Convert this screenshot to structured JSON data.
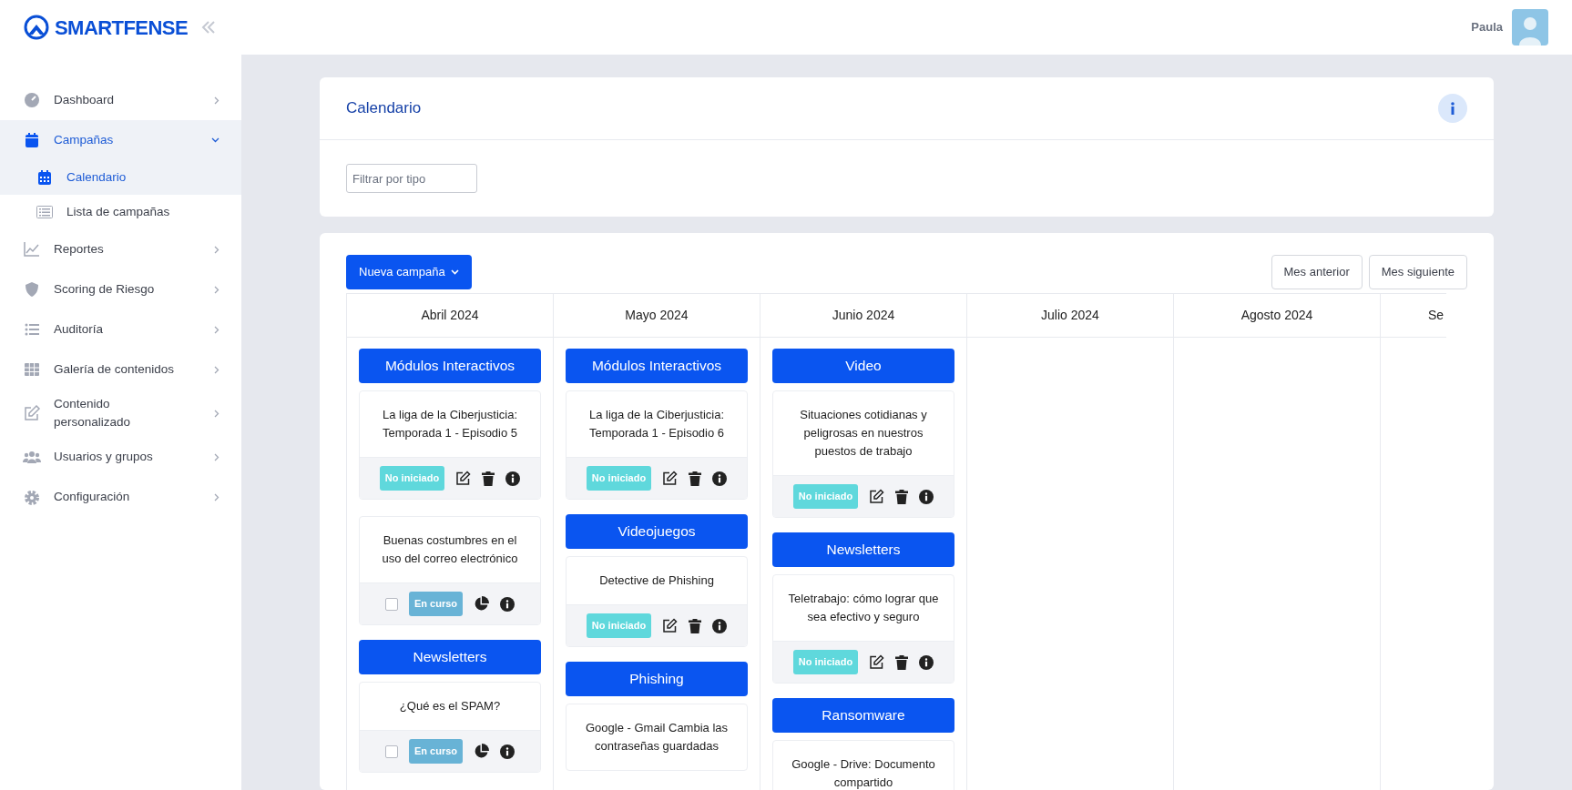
{
  "brand": "SMARTFENSE",
  "user": {
    "name": "Paula"
  },
  "sidebar": {
    "items": [
      {
        "label": "Dashboard",
        "kind": "gauge",
        "expanded": false,
        "selected": false
      },
      {
        "label": "Campañas",
        "kind": "calendar",
        "expanded": true,
        "selected": true,
        "children": [
          {
            "label": "Calendario",
            "kind": "calendar-grid",
            "selected": true
          },
          {
            "label": "Lista de campañas",
            "kind": "list",
            "selected": false
          }
        ]
      },
      {
        "label": "Reportes",
        "kind": "chart",
        "expanded": false,
        "selected": false
      },
      {
        "label": "Scoring de Riesgo",
        "kind": "shield",
        "expanded": false,
        "selected": false
      },
      {
        "label": "Auditoría",
        "kind": "bullets",
        "expanded": false,
        "selected": false
      },
      {
        "label": "Galería de contenidos",
        "kind": "grid",
        "expanded": false,
        "selected": false
      },
      {
        "label": "Contenido personalizado",
        "kind": "edit",
        "expanded": false,
        "selected": false
      },
      {
        "label": "Usuarios y grupos",
        "kind": "users",
        "expanded": false,
        "selected": false
      },
      {
        "label": "Configuración",
        "kind": "gear",
        "expanded": false,
        "selected": false
      }
    ]
  },
  "page": {
    "title": "Calendario",
    "filter": {
      "placeholder": "Filtrar por tipo"
    }
  },
  "calendar": {
    "new_button": "Nueva campaña",
    "prev_button": "Mes anterior",
    "next_button": "Mes siguiente",
    "months": [
      {
        "label": "Abril 2024",
        "groups": [
          {
            "category": "Módulos Interactivos",
            "items": [
              {
                "title": "La liga de la Ciberjusticia: Temporada 1 - Episodio 5",
                "kind": "pending",
                "status": "No iniciado"
              },
              {
                "title": "Buenas costumbres en el uso del correo electrónico",
                "kind": "running",
                "status": "En curso",
                "checked": false
              }
            ]
          },
          {
            "category": "Newsletters",
            "items": [
              {
                "title": "¿Qué es el SPAM?",
                "kind": "running",
                "status": "En curso",
                "checked": false
              }
            ]
          }
        ]
      },
      {
        "label": "Mayo 2024",
        "groups": [
          {
            "category": "Módulos Interactivos",
            "items": [
              {
                "title": "La liga de la Ciberjusticia: Temporada 1 - Episodio 6",
                "kind": "pending",
                "status": "No iniciado"
              }
            ]
          },
          {
            "category": "Videojuegos",
            "items": [
              {
                "title": "Detective de Phishing",
                "kind": "pending",
                "status": "No iniciado"
              }
            ]
          },
          {
            "category": "Phishing",
            "items": [
              {
                "title": "Google - Gmail Cambia las contraseñas guardadas",
                "kind": "cut"
              }
            ]
          }
        ]
      },
      {
        "label": "Junio 2024",
        "groups": [
          {
            "category": "Video",
            "items": [
              {
                "title": "Situaciones cotidianas y peligrosas en nuestros puestos de trabajo",
                "kind": "pending",
                "status": "No iniciado"
              }
            ]
          },
          {
            "category": "Newsletters",
            "items": [
              {
                "title": "Teletrabajo: cómo lograr que sea efectivo y seguro",
                "kind": "pending",
                "status": "No iniciado"
              }
            ]
          },
          {
            "category": "Ransomware",
            "items": [
              {
                "title": "Google - Drive: Documento compartido",
                "kind": "cut"
              }
            ]
          }
        ]
      },
      {
        "label": "Julio 2024"
      },
      {
        "label": "Agosto 2024"
      },
      {
        "label": "Se"
      }
    ]
  }
}
